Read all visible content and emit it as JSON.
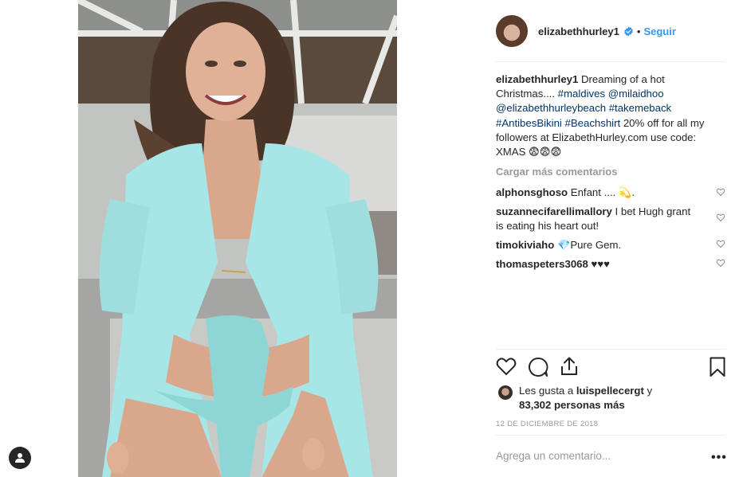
{
  "post": {
    "username": "elizabethhurley1",
    "follow_label": "Seguir",
    "dot": "•",
    "caption": {
      "user": "elizabethhurley1",
      "line1": "Dreaming of a hot",
      "line2_text": "Christmas.... ",
      "tag_maldives": "#maldives",
      "tag_milaidhoo": "@milaidhoo",
      "tag_beach": "@elizabethhurleybeach",
      "tag_takemeback": "#takemeback",
      "tag_antibes": "#AntibesBikini",
      "tag_beachshirt": "#Beachshirt",
      "line4_rest": " 20% off for all my",
      "line5": "followers at ElizabethHurley.com use code:",
      "line6": "XMAS 😨😨😨"
    },
    "load_more": "Cargar más comentarios",
    "comments": [
      {
        "user": "alphonsghoso",
        "text": "Enfant .... 💫."
      },
      {
        "user": "suzannecifarellimallory",
        "text": "I bet Hugh grant",
        "text2": "is eating his heart out!"
      },
      {
        "user": "timokiviaho",
        "text": "💎Pure Gem."
      },
      {
        "user": "thomaspeters3068",
        "text": "♥♥♥"
      }
    ],
    "likes": {
      "prefix": "Les gusta a ",
      "user": "luispellecergt",
      "suffix": " y",
      "count_text": "83,302 personas más"
    },
    "date": "12 DE DICIEMBRE DE 2018",
    "add_comment_placeholder": "Agrega un comentario...",
    "more_options": "•••"
  },
  "icons": {
    "verified": "verified-badge-icon",
    "heart": "heart-icon",
    "comment": "comment-icon",
    "share": "share-icon",
    "bookmark": "bookmark-icon",
    "user": "user-icon"
  },
  "colors": {
    "link_blue": "#3897f0",
    "hashtag": "#003569",
    "muted": "#999999",
    "text": "#262626",
    "divider": "#efefef",
    "shirt": "#a7e6e6"
  }
}
